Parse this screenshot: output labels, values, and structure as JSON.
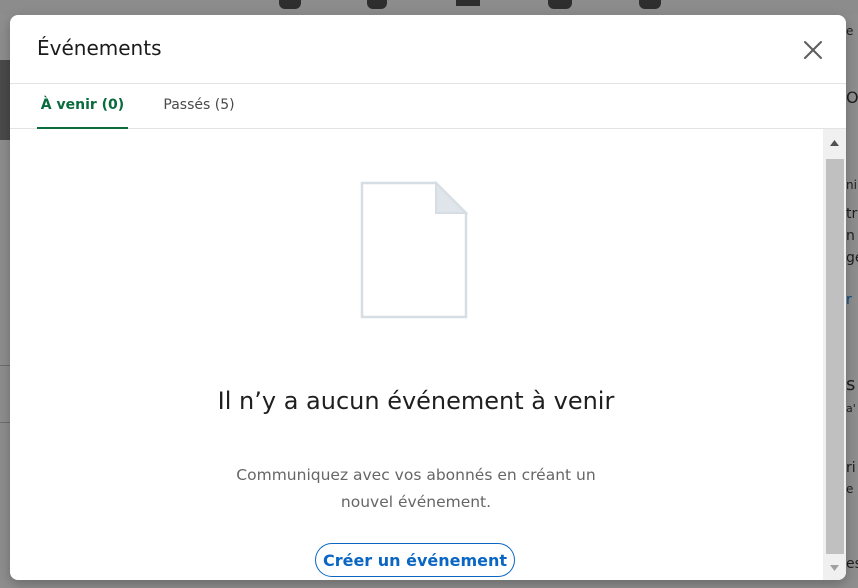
{
  "modal": {
    "title": "Événements",
    "close_icon": "close-icon"
  },
  "tabs": [
    {
      "label": "À venir (0)",
      "active": true
    },
    {
      "label": "Passés (5)",
      "active": false
    }
  ],
  "empty_state": {
    "illustration_icon": "document-icon",
    "title": "Il n’y a aucun événement à venir",
    "description": "Communiquez avec vos abonnés en créant un nouvel événement.",
    "cta_label": "Créer un événement"
  },
  "background": {
    "side_fragments": [
      "O",
      "e",
      "ni",
      "tr",
      "n i",
      "ge",
      "r",
      "s",
      "a'",
      "ri",
      "e",
      "es"
    ]
  },
  "colors": {
    "active_tab": "#0a6b3d",
    "cta": "#0a66c2",
    "overlay": "#8e8e8e"
  }
}
